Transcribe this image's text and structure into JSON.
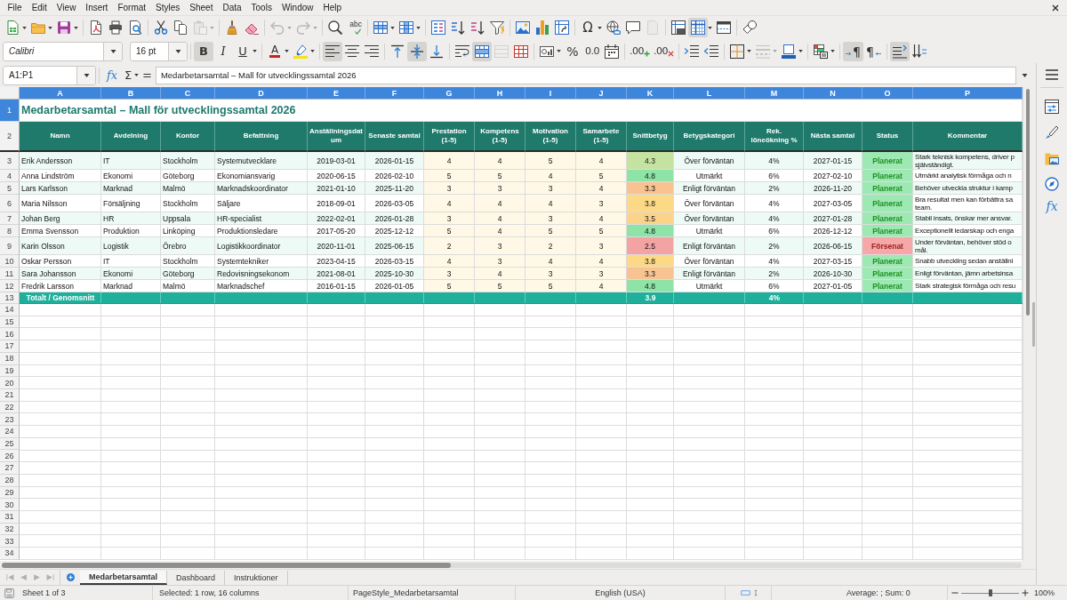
{
  "menu_bar": {
    "items": [
      "File",
      "Edit",
      "View",
      "Insert",
      "Format",
      "Styles",
      "Sheet",
      "Data",
      "Tools",
      "Window",
      "Help"
    ]
  },
  "standard_toolbar": {
    "paste": {
      "disabled": true
    },
    "undo": {
      "disabled": true
    },
    "redo": {
      "disabled": true
    },
    "spelling": {
      "label": "abc"
    },
    "special_character": {
      "label": "Ω"
    },
    "headers_footers": {
      "disabled": true
    },
    "freeze_rows_columns": {
      "on": true
    }
  },
  "formatting_toolbar": {
    "font_name": "Calibri",
    "font_size": "16 pt",
    "bold": {
      "label": "B",
      "on": true
    },
    "italic": {
      "label": "I",
      "on": false
    },
    "underline": {
      "label": "U",
      "on": false
    },
    "font_color": {
      "label": "A"
    },
    "align_left": {
      "on": true
    },
    "align_center": {
      "on": false
    },
    "align_right": {
      "on": false
    },
    "align_top": {
      "on": false
    },
    "center_vertically": {
      "on": true
    },
    "align_bottom": {
      "on": false
    },
    "wrap_text": {
      "on": false
    },
    "merge_and_center": {
      "on": true
    },
    "merge_cells": {
      "disabled": true
    },
    "percent": {
      "label": "%"
    },
    "number": {
      "label": "0.0"
    },
    "add_decimal": {
      "label": ".00"
    },
    "delete_decimal": {
      "label": ".00"
    },
    "border_style": {
      "disabled": true
    },
    "left_to_right": {
      "label": "¶",
      "on": true
    },
    "right_to_left": {
      "label": "¶",
      "on": false
    },
    "text_direction": {
      "on": true
    }
  },
  "formula_bar": {
    "name_box": "A1:P1",
    "function_wizard": "fx",
    "sum": "Σ",
    "equals": "=",
    "content": "Medarbetarsamtal – Mall för utvecklingssamtal 2026"
  },
  "sheet": {
    "columns": [
      {
        "label": "A",
        "selected": true
      },
      {
        "label": "B",
        "selected": true
      },
      {
        "label": "C",
        "selected": true
      },
      {
        "label": "D",
        "selected": true
      },
      {
        "label": "E",
        "selected": true
      },
      {
        "label": "F",
        "selected": true
      },
      {
        "label": "G",
        "selected": true
      },
      {
        "label": "H",
        "selected": true
      },
      {
        "label": "I",
        "selected": true
      },
      {
        "label": "J",
        "selected": true
      },
      {
        "label": "K",
        "selected": true
      },
      {
        "label": "L",
        "selected": true
      },
      {
        "label": "M",
        "selected": true
      },
      {
        "label": "N",
        "selected": true
      },
      {
        "label": "O",
        "selected": true
      },
      {
        "label": "P",
        "selected": true
      }
    ],
    "row_numbers": [
      {
        "label": "1",
        "selected": true
      },
      {
        "label": "2",
        "selected": false
      },
      {
        "label": "3",
        "selected": false
      },
      {
        "label": "4",
        "selected": false
      },
      {
        "label": "5",
        "selected": false
      },
      {
        "label": "6",
        "selected": false
      },
      {
        "label": "7",
        "selected": false
      },
      {
        "label": "8",
        "selected": false
      },
      {
        "label": "9",
        "selected": false
      },
      {
        "label": "10",
        "selected": false
      },
      {
        "label": "11",
        "selected": false
      },
      {
        "label": "12",
        "selected": false
      },
      {
        "label": "13",
        "selected": false
      },
      {
        "label": "14",
        "selected": false
      },
      {
        "label": "15",
        "selected": false
      },
      {
        "label": "16",
        "selected": false
      },
      {
        "label": "17",
        "selected": false
      },
      {
        "label": "18",
        "selected": false
      },
      {
        "label": "19",
        "selected": false
      },
      {
        "label": "20",
        "selected": false
      },
      {
        "label": "21",
        "selected": false
      },
      {
        "label": "22",
        "selected": false
      },
      {
        "label": "23",
        "selected": false
      },
      {
        "label": "24",
        "selected": false
      },
      {
        "label": "25",
        "selected": false
      },
      {
        "label": "26",
        "selected": false
      },
      {
        "label": "27",
        "selected": false
      },
      {
        "label": "28",
        "selected": false
      },
      {
        "label": "29",
        "selected": false
      },
      {
        "label": "30",
        "selected": false
      },
      {
        "label": "31",
        "selected": false
      },
      {
        "label": "32",
        "selected": false
      },
      {
        "label": "33",
        "selected": false
      },
      {
        "label": "34",
        "selected": false
      }
    ],
    "title": "Medarbetarsamtal – Mall för utvecklingssamtal 2026",
    "headings": [
      "Namn",
      "Avdelning",
      "Kontor",
      "Befattning",
      "Anställningsdatum",
      "Senaste samtal",
      "Prestation (1-5)",
      "Kompetens (1-5)",
      "Motivation (1-5)",
      "Samarbete (1-5)",
      "Snittbetyg",
      "Betygskategori",
      "Rek. löneökning %",
      "Nästa samtal",
      "Status",
      "Kommentar"
    ],
    "rows": [
      {
        "name": "Erik Andersson",
        "department": "IT",
        "office": "Stockholm",
        "position": "Systemutvecklare",
        "hired": "2019-03-01",
        "last_review": "2026-01-15",
        "performance": "4",
        "competence": "4",
        "motivation": "5",
        "cooperation": "4",
        "average": {
          "value": "4.3",
          "color": "#c5e3a0"
        },
        "category": "Över förväntan",
        "raise": "4%",
        "next_review": "2027-01-15",
        "status": {
          "label": "Planerat",
          "color": "#9de8b3"
        },
        "comment": [
          "Stark teknisk kompetens, driver p",
          "självständigt."
        ]
      },
      {
        "name": "Anna Lindström",
        "department": "Ekonomi",
        "office": "Göteborg",
        "position": "Ekonomiansvarig",
        "hired": "2020-06-15",
        "last_review": "2026-02-10",
        "performance": "5",
        "competence": "5",
        "motivation": "4",
        "cooperation": "5",
        "average": {
          "value": "4.8",
          "color": "#8ee3a6"
        },
        "category": "Utmärkt",
        "raise": "6%",
        "next_review": "2027-02-10",
        "status": {
          "label": "Planerat",
          "color": "#9de8b3"
        },
        "comment": [
          "Utmärkt analytisk förmåga och n"
        ]
      },
      {
        "name": "Lars Karlsson",
        "department": "Marknad",
        "office": "Malmö",
        "position": "Marknadskoordinator",
        "hired": "2021-01-10",
        "last_review": "2025-11-20",
        "performance": "3",
        "competence": "3",
        "motivation": "3",
        "cooperation": "4",
        "average": {
          "value": "3.3",
          "color": "#f8c391"
        },
        "category": "Enligt förväntan",
        "raise": "2%",
        "next_review": "2026-11-20",
        "status": {
          "label": "Planerat",
          "color": "#9de8b3"
        },
        "comment": [
          "Behöver utveckla struktur i kamp"
        ]
      },
      {
        "name": "Maria Nilsson",
        "department": "Försäljning",
        "office": "Stockholm",
        "position": "Säljare",
        "hired": "2018-09-01",
        "last_review": "2026-03-05",
        "performance": "4",
        "competence": "4",
        "motivation": "4",
        "cooperation": "3",
        "average": {
          "value": "3.8",
          "color": "#fcd987"
        },
        "category": "Över förväntan",
        "raise": "4%",
        "next_review": "2027-03-05",
        "status": {
          "label": "Planerat",
          "color": "#9de8b3"
        },
        "comment": [
          "Bra resultat men kan förbättra sa",
          "team."
        ]
      },
      {
        "name": "Johan Berg",
        "department": "HR",
        "office": "Uppsala",
        "position": "HR-specialist",
        "hired": "2022-02-01",
        "last_review": "2026-01-28",
        "performance": "3",
        "competence": "4",
        "motivation": "3",
        "cooperation": "4",
        "average": {
          "value": "3.5",
          "color": "#fbd38b"
        },
        "category": "Över förväntan",
        "raise": "4%",
        "next_review": "2027-01-28",
        "status": {
          "label": "Planerat",
          "color": "#9de8b3"
        },
        "comment": [
          "Stabil insats, önskar mer ansvar."
        ]
      },
      {
        "name": "Emma Svensson",
        "department": "Produktion",
        "office": "Linköping",
        "position": "Produktionsledare",
        "hired": "2017-05-20",
        "last_review": "2025-12-12",
        "performance": "5",
        "competence": "4",
        "motivation": "5",
        "cooperation": "5",
        "average": {
          "value": "4.8",
          "color": "#8ee3a6"
        },
        "category": "Utmärkt",
        "raise": "6%",
        "next_review": "2026-12-12",
        "status": {
          "label": "Planerat",
          "color": "#9de8b3"
        },
        "comment": [
          "Exceptionellt ledarskap och enga"
        ]
      },
      {
        "name": "Karin Olsson",
        "department": "Logistik",
        "office": "Örebro",
        "position": "Logistikkoordinator",
        "hired": "2020-11-01",
        "last_review": "2025-06-15",
        "performance": "2",
        "competence": "3",
        "motivation": "2",
        "cooperation": "3",
        "average": {
          "value": "2.5",
          "color": "#f4a3a3"
        },
        "category": "Enligt förväntan",
        "raise": "2%",
        "next_review": "2026-06-15",
        "status": {
          "label": "Försenat",
          "color": "#f6a7a7"
        },
        "comment": [
          "Under förväntan, behöver stöd o",
          "mål."
        ]
      },
      {
        "name": "Oskar Persson",
        "department": "IT",
        "office": "Stockholm",
        "position": "Systemtekniker",
        "hired": "2023-04-15",
        "last_review": "2026-03-15",
        "performance": "4",
        "competence": "3",
        "motivation": "4",
        "cooperation": "4",
        "average": {
          "value": "3.8",
          "color": "#fcd987"
        },
        "category": "Över förväntan",
        "raise": "4%",
        "next_review": "2027-03-15",
        "status": {
          "label": "Planerat",
          "color": "#9de8b3"
        },
        "comment": [
          "Snabb utveckling sedan anställni"
        ]
      },
      {
        "name": "Sara Johansson",
        "department": "Ekonomi",
        "office": "Göteborg",
        "position": "Redovisningsekonom",
        "hired": "2021-08-01",
        "last_review": "2025-10-30",
        "performance": "3",
        "competence": "4",
        "motivation": "3",
        "cooperation": "3",
        "average": {
          "value": "3.3",
          "color": "#f8c391"
        },
        "category": "Enligt förväntan",
        "raise": "2%",
        "next_review": "2026-10-30",
        "status": {
          "label": "Planerat",
          "color": "#9de8b3"
        },
        "comment": [
          "Enligt förväntan, jämn arbetsinsa"
        ]
      },
      {
        "name": "Fredrik Larsson",
        "department": "Marknad",
        "office": "Malmö",
        "position": "Marknadschef",
        "hired": "2016-01-15",
        "last_review": "2026-01-05",
        "performance": "5",
        "competence": "5",
        "motivation": "5",
        "cooperation": "4",
        "average": {
          "value": "4.8",
          "color": "#8ee3a6"
        },
        "category": "Utmärkt",
        "raise": "6%",
        "next_review": "2027-01-05",
        "status": {
          "label": "Planerat",
          "color": "#9de8b3"
        },
        "comment": [
          "Stark strategisk förmåga och resu"
        ]
      }
    ],
    "total": {
      "label": "Totalt / Genomsnitt",
      "average": "3.9",
      "raise": "4%"
    }
  },
  "sidebar": {
    "functions": "fx"
  },
  "sheet_navigation": {
    "disabled": true
  },
  "sheet_tabs": [
    {
      "label": "Medarbetarsamtal",
      "selected": true
    },
    {
      "label": "Dashboard",
      "selected": false
    },
    {
      "label": "Instruktioner",
      "selected": false
    }
  ],
  "status_bar": {
    "sheet": "Sheet 1 of 3",
    "selection": "Selected: 1 row, 16 columns",
    "page_style": "PageStyle_Medarbetarsamtal",
    "language": "English (USA)",
    "summary": "Average: ; Sum: 0",
    "zoom": {
      "level": 0.5,
      "reading": "100%"
    }
  }
}
